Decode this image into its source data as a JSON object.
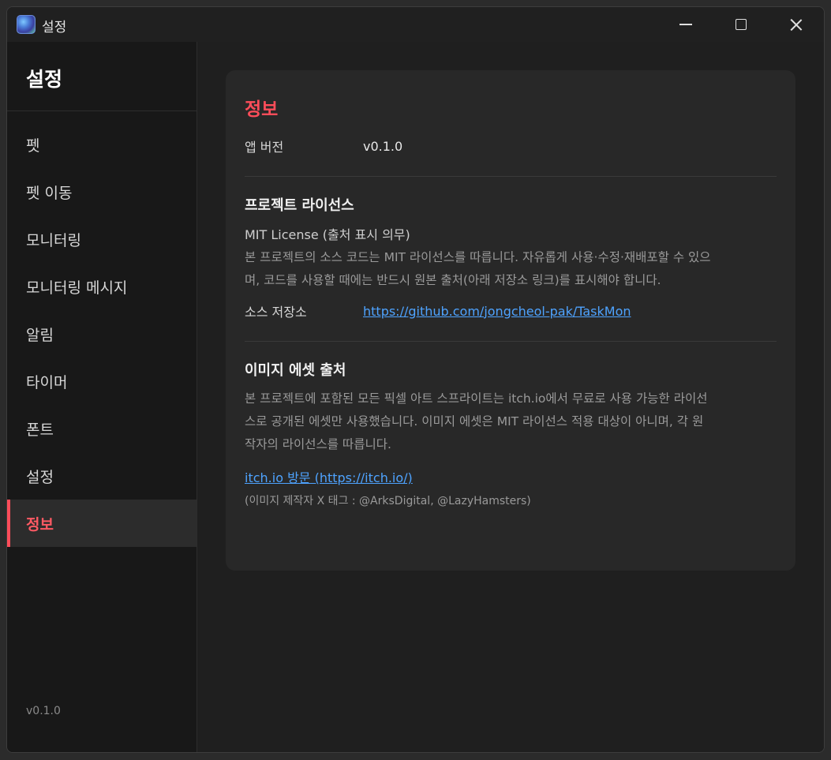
{
  "window": {
    "title": "설정",
    "icon": "app-icon"
  },
  "sidebar": {
    "title": "설정",
    "items": [
      {
        "label": "펫"
      },
      {
        "label": "펫 이동"
      },
      {
        "label": "모니터링"
      },
      {
        "label": "모니터링 메시지"
      },
      {
        "label": "알림"
      },
      {
        "label": "타이머"
      },
      {
        "label": "폰트"
      },
      {
        "label": "설정"
      },
      {
        "label": "정보",
        "active": true
      }
    ],
    "version": "v0.1.0"
  },
  "info": {
    "title": "정보",
    "app_version_label": "앱 버전",
    "app_version_value": "v0.1.0",
    "license_section": {
      "title": "프로젝트 라이선스",
      "license_name": "MIT License (출처 표시 의무)",
      "description_line1": "본 프로젝트의 소스 코드는 MIT 라이선스를 따릅니다. 자유롭게 사용·수정·재배포할 수 있으",
      "description_line2": "며, 코드를 사용할 때에는 반드시 원본 출처(아래 저장소 링크)를 표시해야 합니다.",
      "repo_label": "소스 저장소",
      "repo_link": "https://github.com/jongcheol-pak/TaskMon"
    },
    "asset_section": {
      "title": "이미지 에셋 출처",
      "description_line1": "본 프로젝트에 포함된 모든 픽셀 아트 스프라이트는 itch.io에서 무료로 사용 가능한 라이선",
      "description_line2": "스로 공개된 에셋만 사용했습니다. 이미지 에셋은 MIT 라이선스 적용 대상이 아니며, 각 원",
      "description_line3": "작자의 라이선스를 따릅니다.",
      "visit_link": "itch.io 방문 (https://itch.io/)",
      "credit": "(이미지 제작자 X 태그 : @ArksDigital, @LazyHamsters)"
    }
  },
  "colors": {
    "accent": "#ff4d5a",
    "link": "#4ea3ff",
    "background": "#1f1f1f",
    "card": "#282828"
  }
}
